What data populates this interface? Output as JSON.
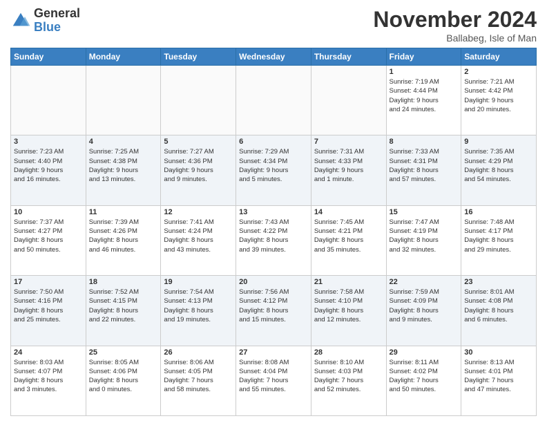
{
  "logo": {
    "general": "General",
    "blue": "Blue"
  },
  "header": {
    "month": "November 2024",
    "location": "Ballabeg, Isle of Man"
  },
  "weekdays": [
    "Sunday",
    "Monday",
    "Tuesday",
    "Wednesday",
    "Thursday",
    "Friday",
    "Saturday"
  ],
  "weeks": [
    [
      {
        "day": "",
        "info": ""
      },
      {
        "day": "",
        "info": ""
      },
      {
        "day": "",
        "info": ""
      },
      {
        "day": "",
        "info": ""
      },
      {
        "day": "",
        "info": ""
      },
      {
        "day": "1",
        "info": "Sunrise: 7:19 AM\nSunset: 4:44 PM\nDaylight: 9 hours\nand 24 minutes."
      },
      {
        "day": "2",
        "info": "Sunrise: 7:21 AM\nSunset: 4:42 PM\nDaylight: 9 hours\nand 20 minutes."
      }
    ],
    [
      {
        "day": "3",
        "info": "Sunrise: 7:23 AM\nSunset: 4:40 PM\nDaylight: 9 hours\nand 16 minutes."
      },
      {
        "day": "4",
        "info": "Sunrise: 7:25 AM\nSunset: 4:38 PM\nDaylight: 9 hours\nand 13 minutes."
      },
      {
        "day": "5",
        "info": "Sunrise: 7:27 AM\nSunset: 4:36 PM\nDaylight: 9 hours\nand 9 minutes."
      },
      {
        "day": "6",
        "info": "Sunrise: 7:29 AM\nSunset: 4:34 PM\nDaylight: 9 hours\nand 5 minutes."
      },
      {
        "day": "7",
        "info": "Sunrise: 7:31 AM\nSunset: 4:33 PM\nDaylight: 9 hours\nand 1 minute."
      },
      {
        "day": "8",
        "info": "Sunrise: 7:33 AM\nSunset: 4:31 PM\nDaylight: 8 hours\nand 57 minutes."
      },
      {
        "day": "9",
        "info": "Sunrise: 7:35 AM\nSunset: 4:29 PM\nDaylight: 8 hours\nand 54 minutes."
      }
    ],
    [
      {
        "day": "10",
        "info": "Sunrise: 7:37 AM\nSunset: 4:27 PM\nDaylight: 8 hours\nand 50 minutes."
      },
      {
        "day": "11",
        "info": "Sunrise: 7:39 AM\nSunset: 4:26 PM\nDaylight: 8 hours\nand 46 minutes."
      },
      {
        "day": "12",
        "info": "Sunrise: 7:41 AM\nSunset: 4:24 PM\nDaylight: 8 hours\nand 43 minutes."
      },
      {
        "day": "13",
        "info": "Sunrise: 7:43 AM\nSunset: 4:22 PM\nDaylight: 8 hours\nand 39 minutes."
      },
      {
        "day": "14",
        "info": "Sunrise: 7:45 AM\nSunset: 4:21 PM\nDaylight: 8 hours\nand 35 minutes."
      },
      {
        "day": "15",
        "info": "Sunrise: 7:47 AM\nSunset: 4:19 PM\nDaylight: 8 hours\nand 32 minutes."
      },
      {
        "day": "16",
        "info": "Sunrise: 7:48 AM\nSunset: 4:17 PM\nDaylight: 8 hours\nand 29 minutes."
      }
    ],
    [
      {
        "day": "17",
        "info": "Sunrise: 7:50 AM\nSunset: 4:16 PM\nDaylight: 8 hours\nand 25 minutes."
      },
      {
        "day": "18",
        "info": "Sunrise: 7:52 AM\nSunset: 4:15 PM\nDaylight: 8 hours\nand 22 minutes."
      },
      {
        "day": "19",
        "info": "Sunrise: 7:54 AM\nSunset: 4:13 PM\nDaylight: 8 hours\nand 19 minutes."
      },
      {
        "day": "20",
        "info": "Sunrise: 7:56 AM\nSunset: 4:12 PM\nDaylight: 8 hours\nand 15 minutes."
      },
      {
        "day": "21",
        "info": "Sunrise: 7:58 AM\nSunset: 4:10 PM\nDaylight: 8 hours\nand 12 minutes."
      },
      {
        "day": "22",
        "info": "Sunrise: 7:59 AM\nSunset: 4:09 PM\nDaylight: 8 hours\nand 9 minutes."
      },
      {
        "day": "23",
        "info": "Sunrise: 8:01 AM\nSunset: 4:08 PM\nDaylight: 8 hours\nand 6 minutes."
      }
    ],
    [
      {
        "day": "24",
        "info": "Sunrise: 8:03 AM\nSunset: 4:07 PM\nDaylight: 8 hours\nand 3 minutes."
      },
      {
        "day": "25",
        "info": "Sunrise: 8:05 AM\nSunset: 4:06 PM\nDaylight: 8 hours\nand 0 minutes."
      },
      {
        "day": "26",
        "info": "Sunrise: 8:06 AM\nSunset: 4:05 PM\nDaylight: 7 hours\nand 58 minutes."
      },
      {
        "day": "27",
        "info": "Sunrise: 8:08 AM\nSunset: 4:04 PM\nDaylight: 7 hours\nand 55 minutes."
      },
      {
        "day": "28",
        "info": "Sunrise: 8:10 AM\nSunset: 4:03 PM\nDaylight: 7 hours\nand 52 minutes."
      },
      {
        "day": "29",
        "info": "Sunrise: 8:11 AM\nSunset: 4:02 PM\nDaylight: 7 hours\nand 50 minutes."
      },
      {
        "day": "30",
        "info": "Sunrise: 8:13 AM\nSunset: 4:01 PM\nDaylight: 7 hours\nand 47 minutes."
      }
    ]
  ]
}
